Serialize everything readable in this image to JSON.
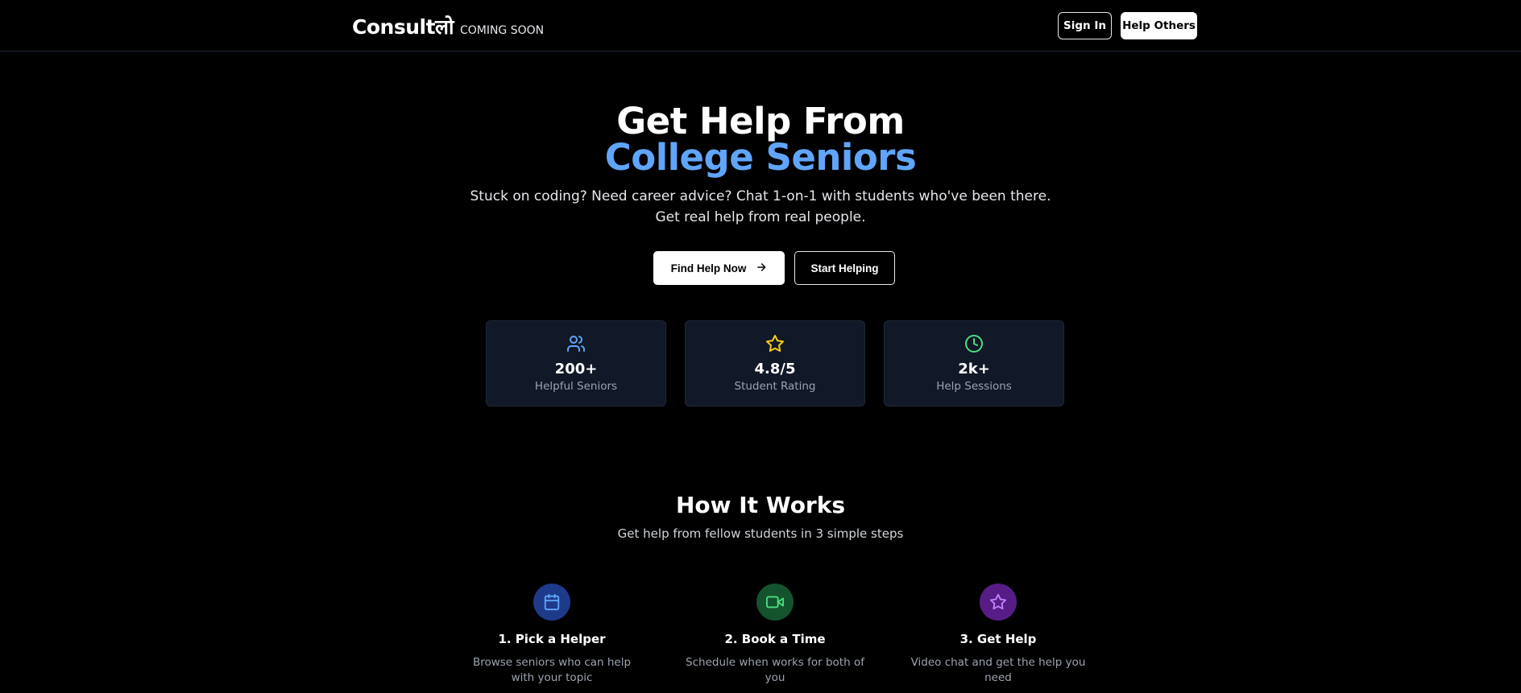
{
  "header": {
    "logo": "Consultलो",
    "badge": "COMING SOON",
    "sign_in": "Sign In",
    "help_others": "Help Others"
  },
  "hero": {
    "title_line1": "Get Help From",
    "title_line2": "College Seniors",
    "subtitle_line1": "Stuck on coding? Need career advice? Chat 1-on-1 with students who've been there.",
    "subtitle_line2": "Get real help from real people.",
    "primary_cta": "Find Help Now",
    "secondary_cta": "Start Helping"
  },
  "stats": [
    {
      "icon": "users-icon",
      "value": "200+",
      "label": "Helpful Seniors",
      "color": "#60a5fa"
    },
    {
      "icon": "star-icon",
      "value": "4.8/5",
      "label": "Student Rating",
      "color": "#facc15"
    },
    {
      "icon": "clock-icon",
      "value": "2k+",
      "label": "Help Sessions",
      "color": "#4ade80"
    }
  ],
  "how_it_works": {
    "title": "How It Works",
    "subtitle": "Get help from fellow students in 3 simple steps",
    "steps": [
      {
        "icon": "calendar-icon",
        "title": "1. Pick a Helper",
        "description": "Browse seniors who can help with your topic",
        "bg": "#1e3a8a",
        "color": "#60a5fa"
      },
      {
        "icon": "video-icon",
        "title": "2. Book a Time",
        "description": "Schedule when works for both of you",
        "bg": "#14532d",
        "color": "#4ade80"
      },
      {
        "icon": "star-icon",
        "title": "3. Get Help",
        "description": "Video chat and get the help you need",
        "bg": "#581c87",
        "color": "#c084fc"
      }
    ]
  },
  "colors": {
    "background": "#000000",
    "accent_blue": "#60a5fa",
    "card_bg": "#111827"
  }
}
